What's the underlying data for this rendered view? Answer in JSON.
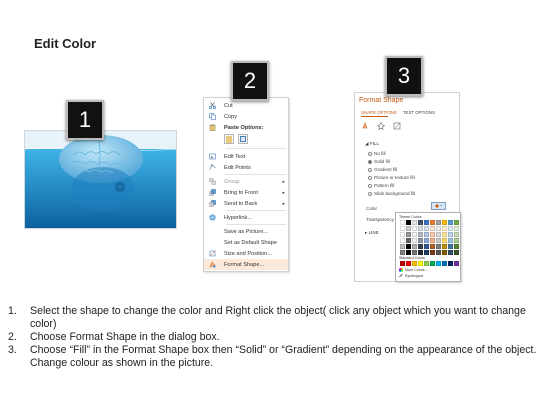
{
  "title": "Edit Color",
  "badges": [
    "1",
    "2",
    "3"
  ],
  "context_menu": {
    "items": [
      {
        "label": "Cut",
        "icon": "scissors-icon"
      },
      {
        "label": "Copy",
        "icon": "copy-icon"
      },
      {
        "label": "Paste Options:",
        "icon": "clipboard-icon"
      },
      {
        "label": "Edit Text",
        "icon": "edit-text-icon"
      },
      {
        "label": "Edit Points",
        "icon": "edit-points-icon"
      },
      {
        "label": "Group",
        "icon": "group-icon"
      },
      {
        "label": "Bring to Front",
        "icon": "bring-front-icon"
      },
      {
        "label": "Send to Back",
        "icon": "send-back-icon"
      },
      {
        "label": "Hyperlink...",
        "icon": "hyperlink-icon"
      },
      {
        "label": "Save as Picture...",
        "icon": ""
      },
      {
        "label": "Set as Default Shape",
        "icon": ""
      },
      {
        "label": "Size and Position...",
        "icon": "size-position-icon"
      },
      {
        "label": "Format Shape...",
        "icon": "format-shape-icon"
      }
    ],
    "highlighted": "Format Shape..."
  },
  "format_shape": {
    "title": "Format Shape",
    "tabs": [
      "SHAPE OPTIONS",
      "TEXT OPTIONS"
    ],
    "fill_header": "FILL",
    "fill_options": [
      {
        "label": "No fill",
        "selected": false
      },
      {
        "label": "Solid fill",
        "selected": true
      },
      {
        "label": "Gradient fill",
        "selected": false
      },
      {
        "label": "Picture or texture fill",
        "selected": false
      },
      {
        "label": "Pattern fill",
        "selected": false
      },
      {
        "label": "Slide background fill",
        "selected": false
      }
    ],
    "color_label": "Color",
    "transparency_label": "Transparency",
    "line_header": "LINE"
  },
  "palette": {
    "theme_header": "Theme Colors",
    "standard_header": "Standard Colors",
    "more_colors": "More Colors...",
    "eyedropper": "Eyedropper",
    "theme_top": [
      "#ffffff",
      "#000000",
      "#e7e6e6",
      "#44546a",
      "#4472c4",
      "#ed7d31",
      "#a5a5a5",
      "#ffc000",
      "#5b9bd5",
      "#70ad47"
    ],
    "standard": [
      "#c00000",
      "#ff0000",
      "#ffc000",
      "#ffff00",
      "#92d050",
      "#00b050",
      "#00b0f0",
      "#0070c0",
      "#002060",
      "#7030a0"
    ]
  },
  "instructions": [
    {
      "num": "1.",
      "text": "Select the shape to change the color and Right click the object( click any object which you want to change color)"
    },
    {
      "num": "2.",
      "text": "Choose Format Shape in the dialog box."
    },
    {
      "num": "3.",
      "text": "Choose “Fill” in the Format Shape box then “Solid” or “Gradient” depending on the appearance of the object. Change colour as shown in the picture."
    }
  ],
  "colors": {
    "accent": "#c55a11",
    "water_top": "#2aa9e0",
    "water_deep": "#0d6fae",
    "menu_highlight": "#fde9d9"
  }
}
